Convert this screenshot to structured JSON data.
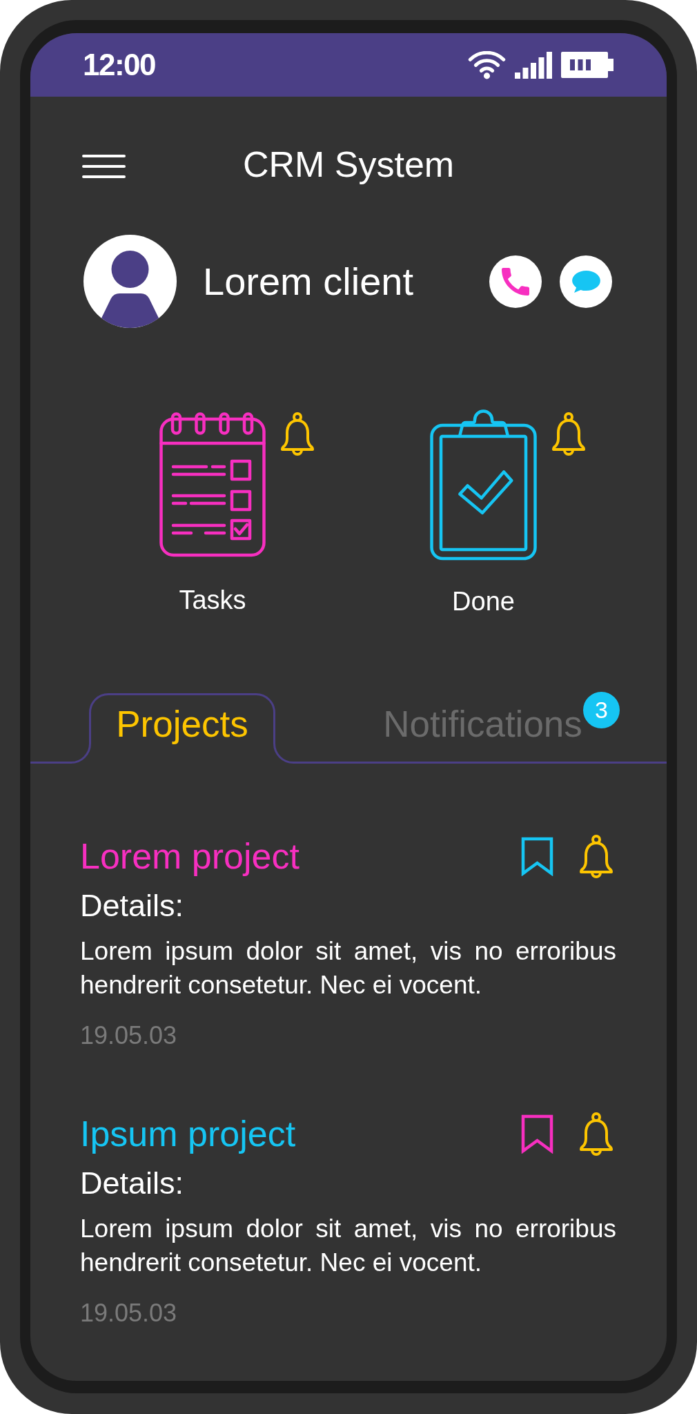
{
  "status_bar": {
    "time": "12:00"
  },
  "app_bar": {
    "title": "CRM System"
  },
  "client": {
    "name": "Lorem client"
  },
  "shortcuts": [
    {
      "kind": "tasks",
      "label": "Tasks"
    },
    {
      "kind": "done",
      "label": "Done"
    }
  ],
  "tabs": [
    {
      "label": "Projects",
      "selected": true
    },
    {
      "label": "Notifications",
      "selected": false,
      "badge": "3"
    }
  ],
  "projects": [
    {
      "title": "Lorem project",
      "color": "#f72fc0",
      "bookmark": {
        "color": "#16c5f3"
      },
      "details_label": "Details:",
      "description": "Lorem ipsum dolor sit amet, vis no erroribus hendrerit consetetur. Nec ei vocent.",
      "date": "19.05.03"
    },
    {
      "title": "Ipsum project",
      "color": "#16c5f3",
      "bookmark": {
        "color": "#f72fc0"
      },
      "details_label": "Details:",
      "description": "Lorem ipsum dolor sit amet, vis no erroribus hendrerit consetetur. Nec ei vocent.",
      "date": "19.05.03"
    }
  ]
}
